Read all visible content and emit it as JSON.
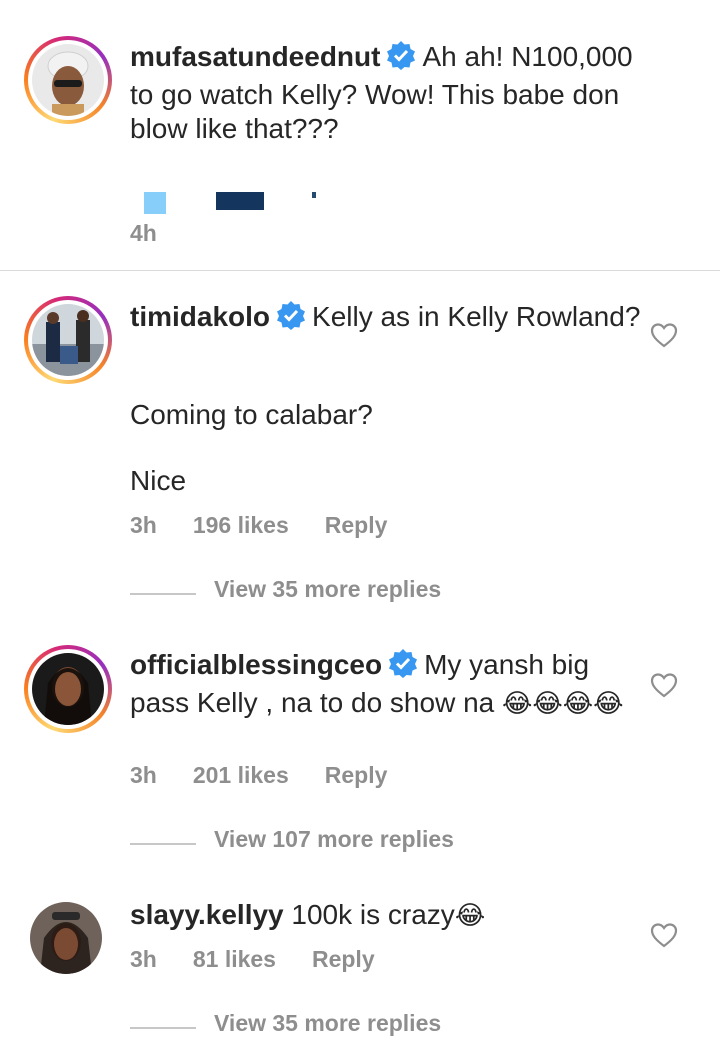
{
  "comments": [
    {
      "username": "mufasatundeednut",
      "verified": true,
      "text": "Ah ah! N100,000 to go watch Kelly? Wow! This babe don blow like that???",
      "time": "4h"
    },
    {
      "username": "timidakolo",
      "verified": true,
      "text_line1": "Kelly as in Kelly Rowland?",
      "text_line2": "Coming to calabar?",
      "text_line3": "Nice",
      "time": "3h",
      "likes": "196 likes",
      "reply": "Reply",
      "view_replies": "View 35 more replies"
    },
    {
      "username": "officialblessingceo",
      "verified": true,
      "text": "My yansh big pass Kelly , na to do show na",
      "emoji": "😂😂😂😂",
      "time": "3h",
      "likes": "201 likes",
      "reply": "Reply",
      "view_replies": "View 107 more replies"
    },
    {
      "username": "slayy.kellyy",
      "verified": false,
      "text": "100k is crazy",
      "emoji": "😂",
      "time": "3h",
      "likes": "81 likes",
      "reply": "Reply",
      "view_replies": "View 35 more replies"
    }
  ],
  "icons": {
    "verified": "verified-badge-icon",
    "like": "heart-outline-icon"
  },
  "colors": {
    "verified": "#3897f0",
    "meta": "#8e8e8e",
    "text": "#262626"
  }
}
